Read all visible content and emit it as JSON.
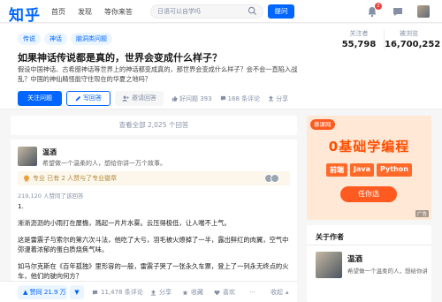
{
  "nav": {
    "logo": "知乎",
    "links": [
      "首页",
      "发现",
      "等你来答"
    ],
    "search_placeholder": "日语可以自学吗",
    "ask_label": "提问",
    "notif_count": "2"
  },
  "question": {
    "tags": [
      "传说",
      "神话",
      "脑洞类问题"
    ],
    "title": "如果神话传说都是真的，世界会变成什么样子？",
    "description": "假设中国神话、古希腊神话等世界上的神话都变成真的，那世界会变成什么样子？会不会一直陷入战乱？中国的神仙精怪能守住现在的华夏之地吗？",
    "stats": [
      {
        "label": "关注者",
        "value": "55,798"
      },
      {
        "label": "被浏览",
        "value": "16,700,252"
      }
    ],
    "follow_label": "关注问题",
    "answer_label": "写回答",
    "invite_label": "邀请回答",
    "good_q_label": "好问题 393",
    "comments_label": "168 条评论",
    "share_label": "分享"
  },
  "view_all_label": "查看全部 2,025 个回答",
  "answer": {
    "author_name": "温酒",
    "author_bio": "希望做一个温柔的人，想给你讲一万个故事。",
    "endorse_text": "专业 已有 2 人赞与了专业徽章",
    "upvote_meta": "219,120 人赞同了该回答",
    "paragraphs": [
      "1.",
      "淅淅沥沥的小雨打在屋檐，溅起一片片水雾。云压得极低，让人喘不上气。",
      "这是雷震子与索尔的第六次斗法，他吃了大亏，羽毛被火燎掉了一半，露出鲜红的肉翼，空气中弥漫着浓郁的蛋白质烧焦气味。",
      "如马尔克斯在《百年孤独》里形容的一般，雷震子哭了一张永久车票，登上了一列永无终点的火车，他们的驶向何方？"
    ],
    "vote_label": "赞同 21.9 万",
    "comments_label": "11,478 条评论",
    "share_label": "分享",
    "favorite_label": "收藏",
    "like_label": "喜欢",
    "collapse_label": "收起"
  },
  "ad": {
    "brand": "慕课网",
    "title": "0基础学编程",
    "chips": [
      "前端",
      "Java",
      "Python"
    ],
    "cta": "任你选",
    "tag": "广告"
  },
  "about": {
    "title": "关于作者",
    "name": "温酒",
    "bio": "希望做一个温柔的人，想给你讲..."
  },
  "colors": {
    "brand": "#0066ff",
    "ad_orange": "#ff5a1f"
  }
}
